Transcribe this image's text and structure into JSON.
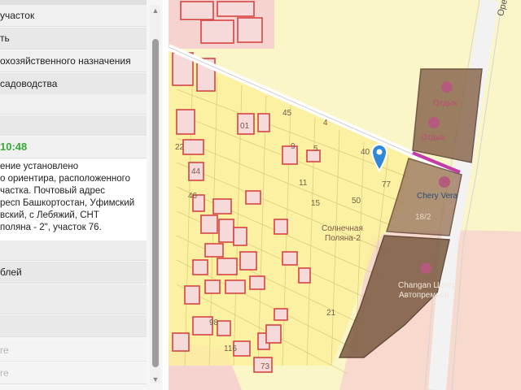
{
  "panel": {
    "rows": [
      "участок",
      "ть",
      "охозяйственного назначения",
      "садоводства",
      "",
      ""
    ],
    "time": "10:48",
    "description": [
      "ение установлено",
      "о ориентира, расположенного",
      "частка. Почтовый адрес",
      "респ Башкортостан, Уфимский",
      "вский, с Лебяжий, СНТ",
      "поляна - 2\", участок 76."
    ],
    "price": "блей",
    "muted_rows": [
      "re",
      "re"
    ]
  },
  "map": {
    "labels": {
      "otdyh1": "Отдых",
      "otdyh2": "Отдых",
      "chery": "Chery Vera",
      "num_18_2": "18/2",
      "solnechnaya": "Солнечная",
      "polyana": "Поляна-2",
      "changan": "Changan Центр",
      "avtopremier": "Автопремьер",
      "orenb": "Оренб",
      "num_40": "40",
      "num_77": "77",
      "num_45": "45",
      "num_22": "22",
      "num_44": "44",
      "num_46": "46",
      "num_15": "15",
      "num_11": "11",
      "num_50": "50",
      "num_98": "98",
      "num_116": "116",
      "num_73": "73",
      "num_21": "21",
      "num_01": "01",
      "num_9": "9",
      "num_5": "5",
      "num_4": "4"
    },
    "colors": {
      "base": "#fbf6c8",
      "parcel_fill": "#f6dada",
      "parcel_stroke": "#d64545",
      "industrial": "#8b6a50",
      "pink_zone": "#f6d3cf",
      "road": "#f2f2f2",
      "pin": "#2f87d8",
      "route": "#c43aa8"
    }
  }
}
